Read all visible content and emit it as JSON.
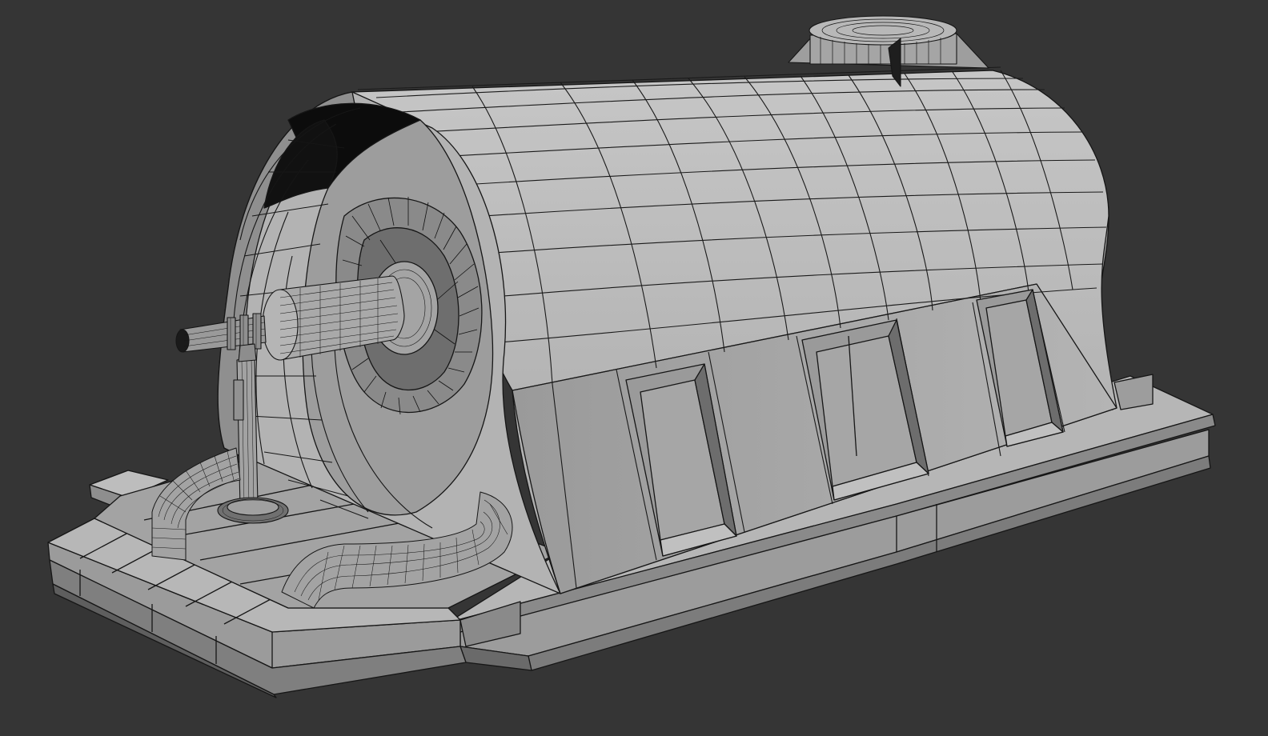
{
  "viewport": {
    "background_color": "#353535",
    "shading_mode": "edged-faces",
    "object_fill": "#a8a8a8",
    "object_fill_light": "#bcbcbc",
    "object_fill_dark": "#7e7e7e",
    "object_fill_shadow": "#141414",
    "wire_color": "#161616"
  },
  "scene": {
    "object": "generator-housing",
    "parts": [
      "base-platform",
      "stator-housing",
      "front-bell-end",
      "rotor-ring",
      "shaft",
      "shaft-support",
      "exciter-dome",
      "side-vents",
      "left-hose",
      "right-hose"
    ]
  }
}
